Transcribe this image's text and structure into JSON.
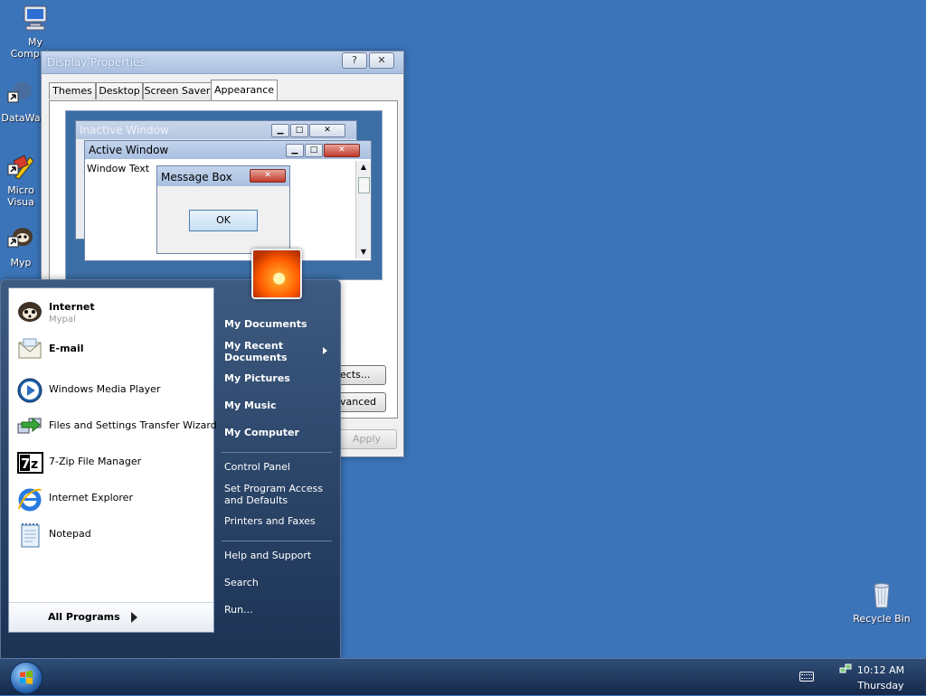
{
  "desktop": {
    "icons": [
      {
        "label": "My Computer",
        "icon": "my-computer-icon"
      },
      {
        "label": "DataWa",
        "icon": "datawa-shortcut-icon"
      },
      {
        "label": "Micro Visua",
        "icon": "microsoft-visual-shortcut-icon"
      },
      {
        "label": "Myp",
        "icon": "mypal-shortcut-icon"
      },
      {
        "label": "Recycle Bin",
        "icon": "recycle-bin-icon"
      }
    ]
  },
  "display_properties": {
    "title": "Display Properties",
    "help_button": "?",
    "close_button": "✕",
    "tabs": [
      "Themes",
      "Desktop",
      "Screen Saver",
      "Appearance"
    ],
    "active_tab": "Appearance",
    "preview": {
      "inactive_window": "Inactive Window",
      "active_window": "Active Window",
      "window_text": "Window Text",
      "message_box": "Message Box",
      "ok": "OK"
    },
    "effects_button": "ects...",
    "advanced_button": "vanced",
    "apply_button": "Apply"
  },
  "start_menu": {
    "pinned": [
      {
        "label": "Internet",
        "sub": "Mypal",
        "icon": "mypal-browser-icon"
      },
      {
        "label": "E-mail",
        "icon": "email-envelope-icon"
      }
    ],
    "recent": [
      {
        "label": "Windows Media Player",
        "icon": "media-player-icon"
      },
      {
        "label": "Files and Settings Transfer Wizard",
        "icon": "transfer-wizard-icon"
      },
      {
        "label": "7-Zip File Manager",
        "icon": "seven-zip-icon"
      },
      {
        "label": "Internet Explorer",
        "icon": "internet-explorer-icon"
      },
      {
        "label": "Notepad",
        "icon": "notepad-icon"
      }
    ],
    "all_programs": "All Programs",
    "right": {
      "my_documents": "My Documents",
      "my_recent_documents_line1": "My Recent",
      "my_recent_documents_line2": "Documents",
      "my_pictures": "My Pictures",
      "my_music": "My Music",
      "my_computer": "My Computer",
      "control_panel": "Control Panel",
      "set_program_line1": "Set Program Access",
      "set_program_line2": "and Defaults",
      "printers": "Printers and Faxes",
      "help": "Help and Support",
      "search": "Search",
      "run": "Run..."
    }
  },
  "taskbar": {
    "time": "10:12 AM",
    "day": "Thursday"
  },
  "colors": {
    "desktop": "#3b74b8",
    "start_menu_dark": "#1c3354",
    "taskbar": "#16294a"
  }
}
